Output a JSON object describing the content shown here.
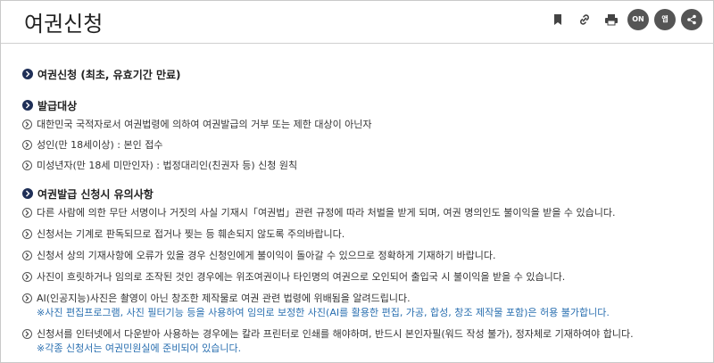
{
  "page": {
    "title": "여권신청"
  },
  "toolbar": {
    "icons": [
      "bookmark-icon",
      "link-icon",
      "print-icon",
      "service-badge-icon",
      "mobile-badge-icon",
      "share-icon"
    ],
    "badge1_text": "ON",
    "badge2_text": "앱"
  },
  "sections": [
    {
      "title": "여권신청 (최초, 유효기간 만료)",
      "items": []
    },
    {
      "title": "발급대상",
      "items": [
        {
          "text": "대한민국 국적자로서 여권법령에 의하여 여권발급의 거부 또는 제한 대상이 아닌자"
        },
        {
          "text": "성인(만 18세이상) : 본인 접수"
        },
        {
          "text": "미성년자(만 18세 미만인자) : 법정대리인(친권자 등) 신청 원칙"
        }
      ]
    },
    {
      "title": "여권발급 신청시 유의사항",
      "items": [
        {
          "text": "다른 사람에 의한 무단 서명이나 거짓의 사실 기재시「여권법」관련 규정에 따라 처벌을 받게 되며, 여권 명의인도 불이익을 받을 수 있습니다."
        },
        {
          "text": "신청서는 기계로 판독되므로 접거나 찢는 등 훼손되지 않도록 주의바랍니다."
        },
        {
          "text": "신청서 상의 기재사항에 오류가 있을 경우 신청인에게 불이익이 돌아갈 수 있으므로 정확하게 기재하기 바랍니다."
        },
        {
          "text": "사진이 흐릿하거나 임의로 조작된 것인 경우에는 위조여권이나 타인명의 여권으로 오인되어 출입국 시 불이익을 받을 수 있습니다."
        },
        {
          "text": "AI(인공지능)사진은 촬영이 아닌 창조한 제작물로 여권 관련 법령에 위배됨을 알려드립니다.",
          "note": "※사진 편집프로그램, 사진 필터기능 등을 사용하여 임의로 보정한 사진(AI를 활용한 편집, 가공, 합성, 창조 제작물 포함)은 허용 불가합니다."
        },
        {
          "text": "신청서를 인터넷에서 다운받아 사용하는 경우에는 칼라 프린터로 인쇄를 해야하며, 반드시 본인자필(워드 작성 불가), 정자체로 기재하여야 합니다.",
          "note": "※각종 신청서는 여권민원실에 준비되어 있습니다."
        }
      ]
    }
  ]
}
